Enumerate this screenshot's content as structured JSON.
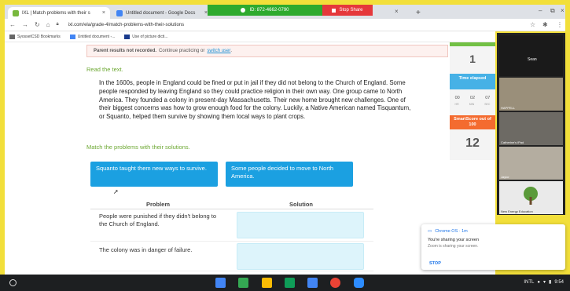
{
  "browser": {
    "tabs": [
      {
        "title": "IXL | Match problems with their s",
        "close": "×"
      },
      {
        "title": "Untitled document - Google Docs",
        "close": "×"
      }
    ],
    "new_tab": "+",
    "share_id": "ID: 872-4662-0790",
    "stop_share": "Stop Share",
    "tab_close_2": "×",
    "url": "ixl.com/ela/grade-4/match-problems-with-their-solutions",
    "bookmarks": [
      "SyossetCSD Bookmarks",
      "Untitled document -...",
      "Use of picture dicti..."
    ]
  },
  "page": {
    "alert_bold": "Parent results not recorded.",
    "alert_text": "Continue practicing or",
    "alert_link": "switch user",
    "read_label": "Read the text.",
    "passage": "In the 1600s, people in England could be fined or put in jail if they did not belong to the Church of England. Some people responded by leaving England so they could practice religion in their own way. One group came to North America. They founded a colony in present-day Massachusetts. Their new home brought new challenges. One of their biggest concerns was how to grow enough food for the colony. Luckily, a Native American named Tisquantum, or Squanto, helped them survive by showing them local ways to plant crops.",
    "match_label": "Match the problems with their solutions.",
    "tiles": [
      "Squanto taught them new ways to survive.",
      "Some people decided to move to North America."
    ],
    "headers": {
      "problem": "Problem",
      "solution": "Solution"
    },
    "problems": [
      "People were punished if they didn't belong to the Church of England.",
      "The colony was in danger of failure."
    ]
  },
  "score": {
    "questions": "1",
    "time_label": "Time elapsed",
    "time": [
      "00",
      "02",
      "07"
    ],
    "time_units": [
      "HR",
      "MIN",
      "SEC"
    ],
    "smart_label": "SmartScore out of 100",
    "smart_value": "12"
  },
  "zoom": {
    "participants": [
      "Sean",
      "HAPPELL",
      "Catherine's iPad",
      "Jaylor",
      "New Energy Education"
    ]
  },
  "notification": {
    "source": "Chrome OS · 1m",
    "title": "You're sharing your screen",
    "body": "Zoom is sharing your screen.",
    "action": "STOP"
  },
  "shelf": {
    "locale": "INTL",
    "time": "9:54",
    "app_colors": [
      "#4285f4",
      "#34a853",
      "#fbbc05",
      "#0f9d58",
      "#4285f4",
      "#ea4335",
      "#2d8cff"
    ]
  }
}
